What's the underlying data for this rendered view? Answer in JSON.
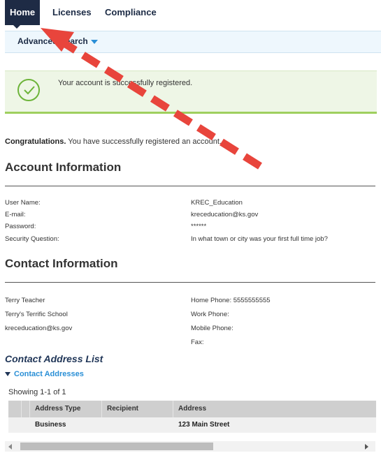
{
  "nav": {
    "tabs": [
      {
        "label": "Home",
        "active": true
      },
      {
        "label": "Licenses",
        "active": false
      },
      {
        "label": "Compliance",
        "active": false
      }
    ]
  },
  "subnav": {
    "advanced_search": "Advanced Search"
  },
  "alert": {
    "message": "Your account is successfully registered."
  },
  "congrats": {
    "bold": "Congratulations.",
    "text": " You have successfully registered an account."
  },
  "account": {
    "title": "Account Information",
    "rows": [
      {
        "label": "User Name:",
        "value": "KREC_Education"
      },
      {
        "label": "E-mail:",
        "value": "kreceducation@ks.gov"
      },
      {
        "label": "Password:",
        "value": "******"
      },
      {
        "label": "Security Question:",
        "value": "In what town or city was your first full time job?"
      }
    ]
  },
  "contact": {
    "title": "Contact Information",
    "left": [
      "Terry Teacher",
      "Terry's Terrific School",
      "kreceducation@ks.gov"
    ],
    "phones": [
      {
        "label": "Home Phone:",
        "value": "5555555555"
      },
      {
        "label": "Work Phone:",
        "value": ""
      },
      {
        "label": "Mobile Phone:",
        "value": ""
      },
      {
        "label": "Fax:",
        "value": ""
      }
    ]
  },
  "address_list": {
    "title": "Contact Address List",
    "toggle_label": "Contact Addresses",
    "showing": "Showing 1-1 of 1",
    "columns": [
      "Address Type",
      "Recipient",
      "Address"
    ],
    "rows": [
      {
        "type": "Business",
        "recipient": "",
        "address": "123 Main Street"
      }
    ]
  },
  "colors": {
    "nav_active": "#1e2b45",
    "link_blue": "#2a8fd6",
    "success_border": "#9fcf5e",
    "annotation_arrow": "#e8453c"
  }
}
